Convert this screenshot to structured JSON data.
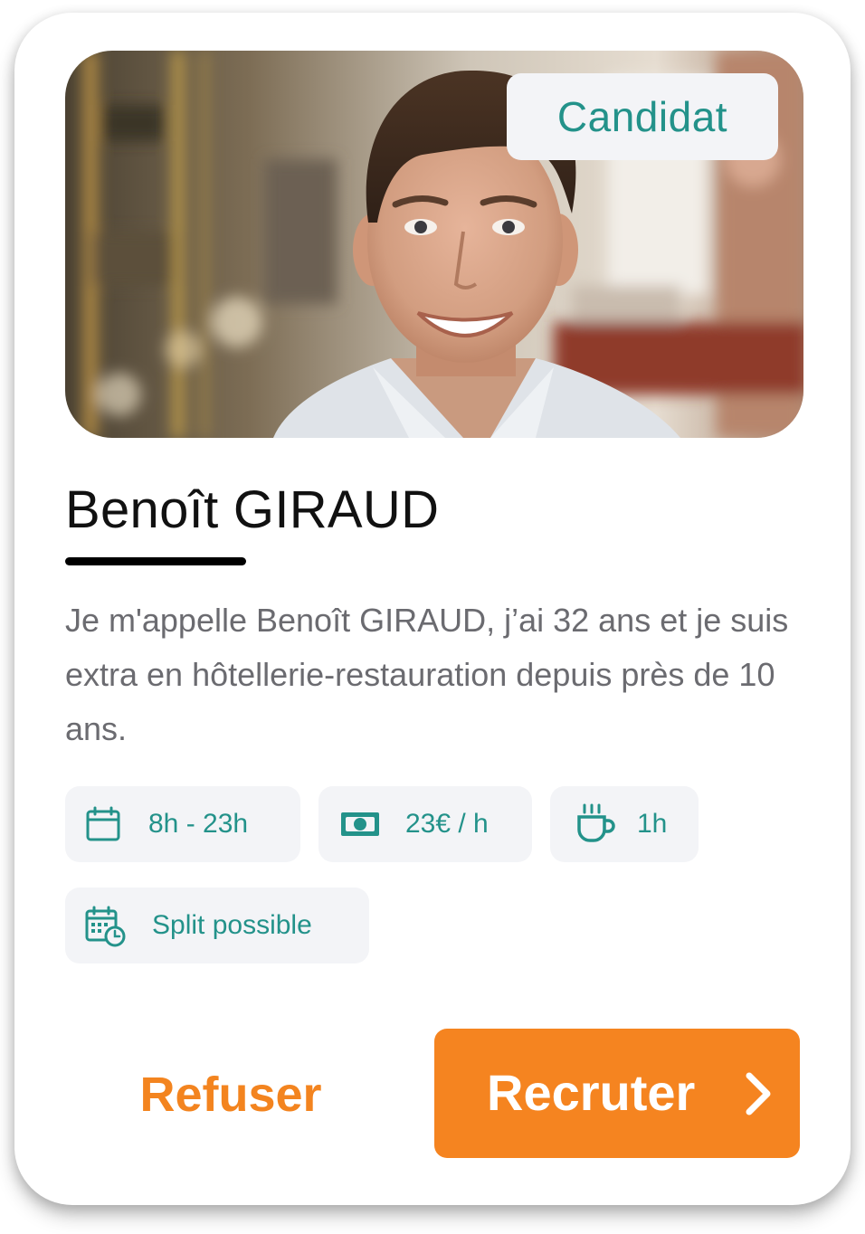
{
  "profile": {
    "badge": "Candidat",
    "name": "Benoît GIRAUD",
    "bio": "Je m'appelle Benoît GIRAUD, j’ai 32 ans et je suis extra en hôtellerie-restauration depuis près de 10 ans."
  },
  "chips": {
    "hours": {
      "icon": "calendar-icon",
      "label": "8h - 23h"
    },
    "rate": {
      "icon": "banknote-icon",
      "label": "23€ / h"
    },
    "break": {
      "icon": "coffee-cup-icon",
      "label": "1h"
    },
    "split": {
      "icon": "calendar-clock-icon",
      "label": "Split possible"
    }
  },
  "actions": {
    "refuse_label": "Refuser",
    "recruit_label": "Recruter"
  },
  "colors": {
    "accent_teal": "#23928a",
    "accent_orange": "#f58420",
    "chip_background": "#f3f4f7",
    "body_text": "#6b6b70"
  }
}
